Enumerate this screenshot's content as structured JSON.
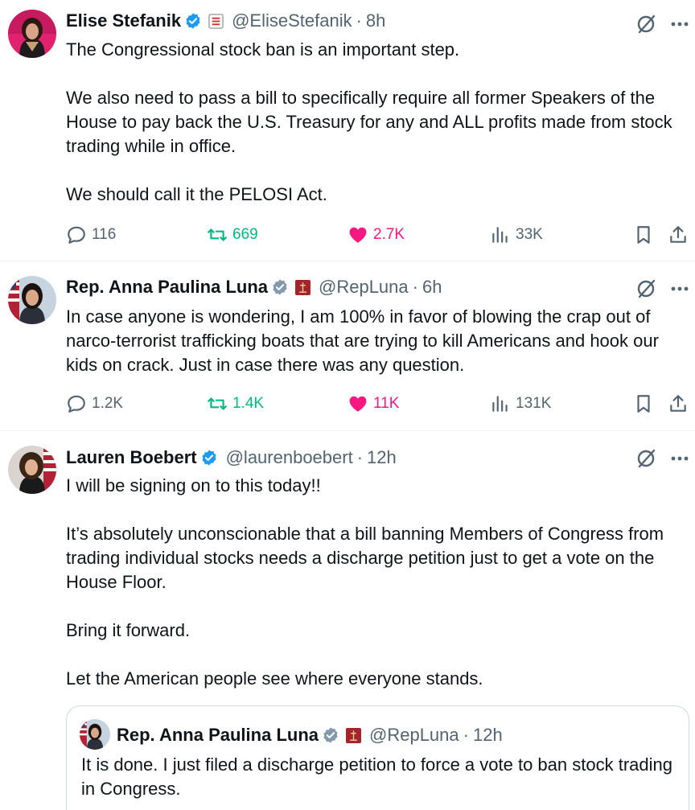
{
  "colors": {
    "verified_blue": "#1d9bf0",
    "verified_gray": "#829aab",
    "retweet_green": "#00ba7c",
    "like_pink": "#f91880",
    "secondary_text": "#536471",
    "divider": "#eff3f4"
  },
  "tweets": [
    {
      "name": "Elise Stefanik",
      "badge": "blue-verified-icon",
      "affiliation_icon": "affiliation-badge-icon",
      "handle": "@EliseStefanik",
      "separator": "·",
      "time": "8h",
      "paragraphs": [
        "The Congressional stock ban is an important step.",
        "We also need to pass a bill to specifically require all former Speakers of the House to pay back the U.S. Treasury for any and ALL profits made from stock trading while in office.",
        "We should call it the PELOSI Act."
      ],
      "replies": "116",
      "reposts": "669",
      "likes": "2.7K",
      "views": "33K",
      "liked": true
    },
    {
      "name": "Rep. Anna Paulina Luna",
      "badge": "gray-verified-icon",
      "affiliation_icon": "us-house-seal-icon",
      "handle": "@RepLuna",
      "separator": "·",
      "time": "6h",
      "paragraphs": [
        "In case anyone is wondering, I am 100% in favor of blowing the crap out of narco-terrorist trafficking boats that are trying to kill Americans and hook our kids on crack. Just in case there was any question."
      ],
      "replies": "1.2K",
      "reposts": "1.4K",
      "likes": "11K",
      "views": "131K",
      "liked": true
    },
    {
      "name": "Lauren Boebert",
      "badge": "blue-verified-icon",
      "handle": "@laurenboebert",
      "separator": "·",
      "time": "12h",
      "paragraphs": [
        "I will be signing on to this today!!",
        "It’s absolutely unconscionable that a bill banning Members of Congress from trading individual stocks needs a discharge petition just to get a vote on the House Floor.",
        "Bring it forward.",
        "Let the American people see where everyone stands."
      ],
      "quote": {
        "name": "Rep. Anna Paulina Luna",
        "badge": "gray-verified-icon",
        "affiliation_icon": "us-house-seal-icon",
        "handle": "@RepLuna",
        "separator": "·",
        "time": "12h",
        "text": "It is done. I just filed a discharge petition to force a vote to ban stock trading in Congress."
      }
    }
  ]
}
